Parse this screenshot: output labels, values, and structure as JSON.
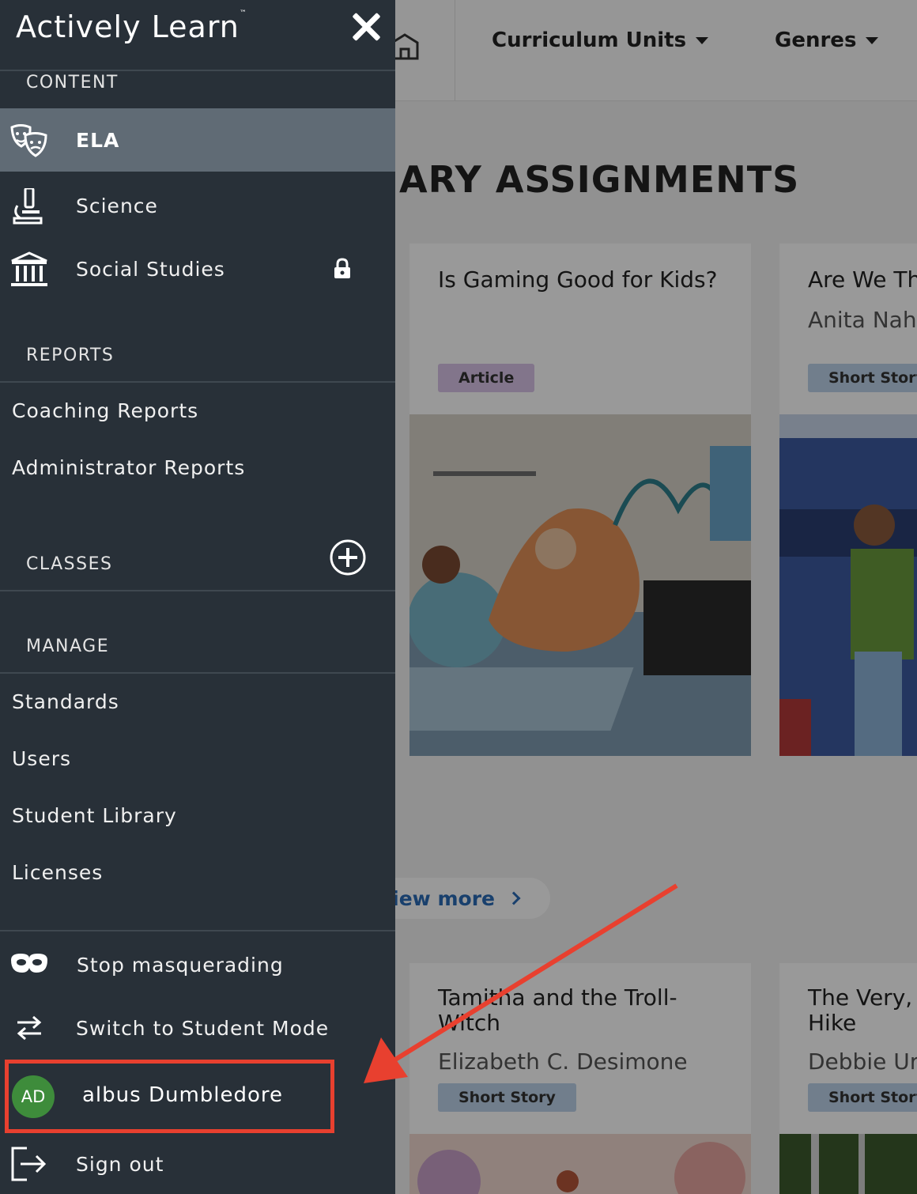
{
  "app": {
    "brand": "Actively Learn",
    "brand_mark": "™"
  },
  "topnav": {
    "items": [
      {
        "label": "Curriculum Units"
      },
      {
        "label": "Genres"
      }
    ]
  },
  "main": {
    "section_title": "ARY ASSIGNMENTS",
    "cards": [
      {
        "title": "Is Gaming Good for Kids?",
        "type": "Article"
      },
      {
        "title": "Are We Th",
        "author": "Anita Nah",
        "type": "Short Story"
      },
      {
        "title_line1": "Tamitha and the Troll-",
        "title_line2": "Witch",
        "author": "Elizabeth C. Desimone",
        "type": "Short Story"
      },
      {
        "title_line1": "The Very, ",
        "title_line2": "Hike",
        "author": "Debbie Ur",
        "type": "Short Story"
      }
    ],
    "view_more": "View more"
  },
  "sidebar": {
    "content_label": "CONTENT",
    "content_items": [
      {
        "label": "ELA",
        "icon": "theater-masks-icon",
        "active": true
      },
      {
        "label": "Science",
        "icon": "microscope-icon"
      },
      {
        "label": "Social Studies",
        "icon": "institution-icon",
        "locked": true
      }
    ],
    "reports_label": "REPORTS",
    "reports_items": [
      "Coaching Reports",
      "Administrator Reports"
    ],
    "classes_label": "CLASSES",
    "manage_label": "MANAGE",
    "manage_items": [
      "Standards",
      "Users",
      "Student Library",
      "Licenses"
    ],
    "stop_masquerading": "Stop masquerading",
    "switch_mode": "Switch to Student Mode",
    "user": {
      "initials": "AD",
      "name": "albus Dumbledore"
    },
    "sign_out": "Sign out"
  },
  "colors": {
    "sidebar_bg": "#283038",
    "active_item_bg": "#606b75",
    "avatar_green": "#3e8c3b",
    "annotation_red": "#e8402f",
    "link_blue": "#2a6cb6"
  }
}
